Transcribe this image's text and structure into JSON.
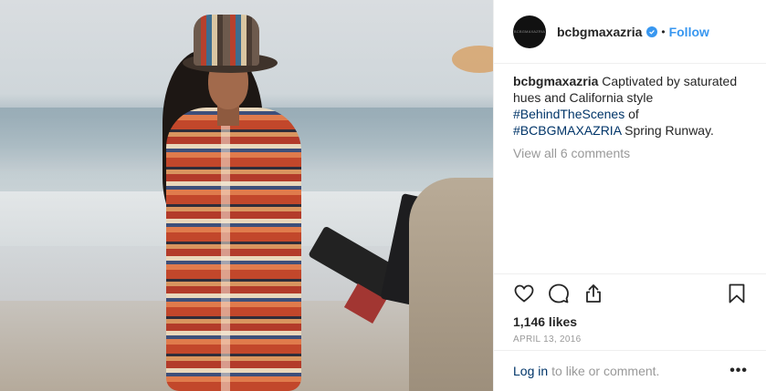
{
  "header": {
    "avatar_text": "BCBGMAXAZRIA",
    "username": "bcbgmaxazria",
    "separator": "•",
    "follow_label": "Follow"
  },
  "caption": {
    "username": "bcbgmaxazria",
    "text_1": " Captivated by saturated hues and California style ",
    "hashtag_1": "#BehindTheScenes",
    "text_2": " of ",
    "hashtag_2": "#BCBGMAXAZRIA",
    "text_3": " Spring Runway."
  },
  "view_all_comments": "View all 6 comments",
  "likes": "1,146 likes",
  "date": "APRIL 13, 2016",
  "login": {
    "link": "Log in",
    "text": "to like or comment.",
    "more": "•••"
  },
  "colors": {
    "accent": "#3897f0",
    "hashtag": "#003569",
    "muted": "#999999",
    "text": "#262626"
  },
  "icons": [
    "heart-icon",
    "comment-icon",
    "share-icon",
    "bookmark-icon",
    "verified-icon",
    "more-options-icon"
  ]
}
